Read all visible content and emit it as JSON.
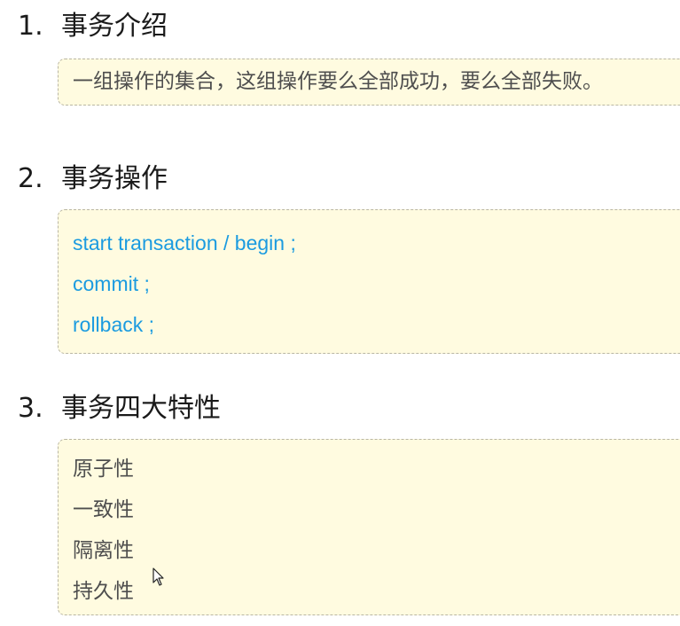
{
  "sections": [
    {
      "number": "1.",
      "title": "事务介绍",
      "lines": [
        "一组操作的集合，这组操作要么全部成功，要么全部失败。"
      ]
    },
    {
      "number": "2.",
      "title": "事务操作",
      "lines": [
        "start transaction / begin ;",
        "commit ;",
        "rollback ;"
      ]
    },
    {
      "number": "3.",
      "title": "事务四大特性",
      "lines": [
        "原子性",
        "一致性",
        "隔离性",
        "持久性"
      ]
    }
  ],
  "colors": {
    "box_background": "#fffbe0",
    "code_text": "#1b9be0",
    "body_text": "#4e4e4e"
  }
}
